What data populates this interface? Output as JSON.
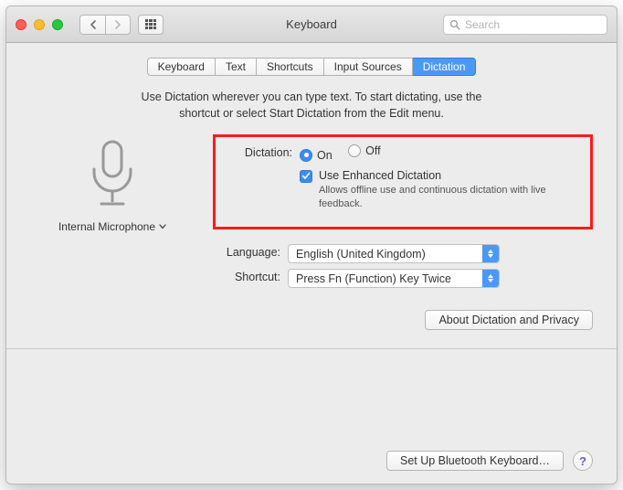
{
  "window": {
    "title": "Keyboard"
  },
  "search": {
    "placeholder": "Search"
  },
  "tabs": [
    "Keyboard",
    "Text",
    "Shortcuts",
    "Input Sources",
    "Dictation"
  ],
  "active_tab": "Dictation",
  "description": "Use Dictation wherever you can type text. To start dictating, use the shortcut or select Start Dictation from the Edit menu.",
  "mic": {
    "label": "Internal Microphone"
  },
  "dictation": {
    "label": "Dictation:",
    "on": "On",
    "off": "Off",
    "value": "On",
    "enhanced_label": "Use Enhanced Dictation",
    "enhanced_hint": "Allows offline use and continuous dictation with live feedback.",
    "enhanced_checked": true
  },
  "language": {
    "label": "Language:",
    "value": "English (United Kingdom)"
  },
  "shortcut": {
    "label": "Shortcut:",
    "value": "Press Fn (Function) Key Twice"
  },
  "about_button": "About Dictation and Privacy",
  "bluetooth_button": "Set Up Bluetooth Keyboard…",
  "help": "?"
}
